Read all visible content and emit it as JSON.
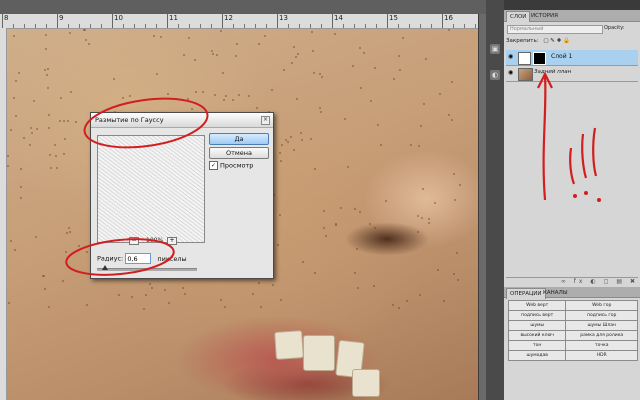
{
  "panel": {
    "tabs": [
      "СЛОИ",
      "ИСТОРИЯ"
    ],
    "blend_mode": "Нормальный",
    "opacity_label": "Opacity:",
    "lock_label": "Закрепить:",
    "layers": [
      {
        "name": "Слой 1",
        "selected": true
      },
      {
        "name": "Задний план",
        "selected": false
      }
    ],
    "bottom_icons": "∞ fx ◐ ◻ ▤ ✖"
  },
  "actions": {
    "tabs": [
      "ОПЕРАЦИИ",
      "КАНАЛЫ"
    ],
    "rows": [
      [
        "Web верт",
        "Web гор"
      ],
      [
        "подпись верт",
        "подпись гор"
      ],
      [
        "шумы",
        "шумы Шлан"
      ],
      [
        "высокий ключ",
        "рамка для ролика"
      ],
      [
        "тон",
        "точка"
      ],
      [
        "шумодав",
        "HDR"
      ]
    ]
  },
  "dialog": {
    "title": "Размытие по Гауссу",
    "ok": "Да",
    "cancel": "Отмена",
    "preview_label": "Просмотр",
    "preview_checked": "✓",
    "zoom": "100%",
    "zoom_out": "−",
    "zoom_in": "+",
    "radius_label": "Радиус:",
    "radius_value": "0,6",
    "radius_unit": "пикселы"
  },
  "ruler": {
    "labels": [
      "8",
      "9",
      "10",
      "11",
      "12",
      "13",
      "14",
      "15",
      "16"
    ]
  },
  "colors": {
    "annotation": "#d21e1e",
    "selection": "#a9d1ef",
    "ok_button": "#9fcbf2"
  }
}
